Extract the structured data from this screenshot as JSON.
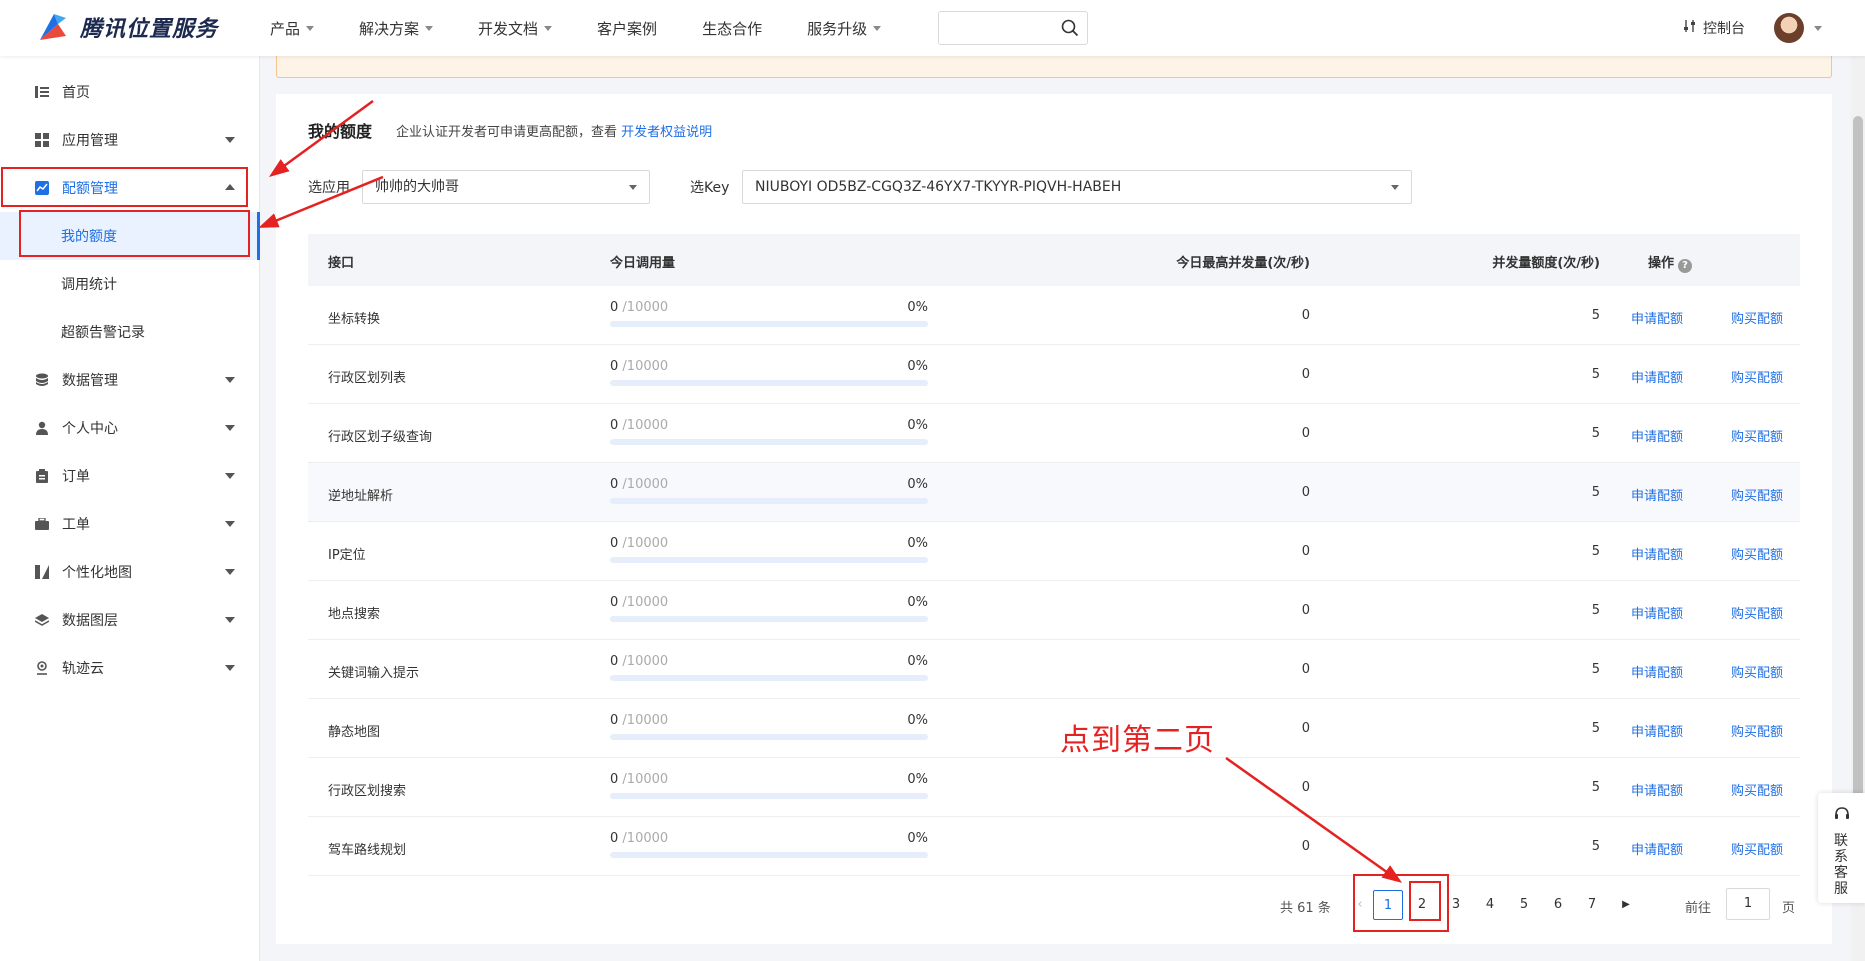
{
  "header": {
    "logo_text": "腾讯位置服务",
    "nav": [
      "产品",
      "解决方案",
      "开发文档",
      "客户案例",
      "生态合作",
      "服务升级"
    ],
    "search_placeholder": "",
    "console_label": "控制台"
  },
  "sidebar": {
    "items": [
      {
        "label": "首页"
      },
      {
        "label": "应用管理"
      },
      {
        "label": "配额管理"
      },
      {
        "label": "我的额度"
      },
      {
        "label": "调用统计"
      },
      {
        "label": "超额告警记录"
      },
      {
        "label": "数据管理"
      },
      {
        "label": "个人中心"
      },
      {
        "label": "订单"
      },
      {
        "label": "工单"
      },
      {
        "label": "个性化地图"
      },
      {
        "label": "数据图层"
      },
      {
        "label": "轨迹云"
      }
    ]
  },
  "main": {
    "title": "我的额度",
    "hint_prefix": "企业认证开发者可申请更高配额，查看",
    "hint_link": "开发者权益说明",
    "app_label": "选应用",
    "app_value": "帅帅的大帅哥",
    "key_label": "选Key",
    "key_value": "NIUBOYI OD5BZ-CGQ3Z-46YX7-TKYYR-PIQVH-HABEH"
  },
  "table": {
    "headers": {
      "api": "接口",
      "today_calls": "今日调用量",
      "peak_concurrency": "今日最高并发量(次/秒)",
      "concurrency_quota": "并发量额度(次/秒)",
      "actions": "操作"
    },
    "apply_label": "申请配额",
    "buy_label": "购买配额",
    "rows": [
      {
        "api": "坐标转换",
        "used": "0",
        "total": "/10000",
        "pct": "0%",
        "progress": 0,
        "peak": "0",
        "quota": "5"
      },
      {
        "api": "行政区划列表",
        "used": "0",
        "total": "/10000",
        "pct": "0%",
        "progress": 0,
        "peak": "0",
        "quota": "5"
      },
      {
        "api": "行政区划子级查询",
        "used": "0",
        "total": "/10000",
        "pct": "0%",
        "progress": 0,
        "peak": "0",
        "quota": "5"
      },
      {
        "api": "逆地址解析",
        "used": "0",
        "total": "/10000",
        "pct": "0%",
        "progress": 0,
        "peak": "0",
        "quota": "5"
      },
      {
        "api": "IP定位",
        "used": "0",
        "total": "/10000",
        "pct": "0%",
        "progress": 0,
        "peak": "0",
        "quota": "5"
      },
      {
        "api": "地点搜索",
        "used": "0",
        "total": "/10000",
        "pct": "0%",
        "progress": 0,
        "peak": "0",
        "quota": "5"
      },
      {
        "api": "关键词输入提示",
        "used": "0",
        "total": "/10000",
        "pct": "0%",
        "progress": 0,
        "peak": "0",
        "quota": "5"
      },
      {
        "api": "静态地图",
        "used": "0",
        "total": "/10000",
        "pct": "0%",
        "progress": 0,
        "peak": "0",
        "quota": "5"
      },
      {
        "api": "行政区划搜索",
        "used": "0",
        "total": "/10000",
        "pct": "0%",
        "progress": 0,
        "peak": "0",
        "quota": "5"
      },
      {
        "api": "驾车路线规划",
        "used": "0",
        "total": "/10000",
        "pct": "0%",
        "progress": 0,
        "peak": "0",
        "quota": "5"
      }
    ]
  },
  "pagination": {
    "total_text": "共 61 条",
    "pages": [
      "1",
      "2",
      "3",
      "4",
      "5",
      "6",
      "7"
    ],
    "current": "1",
    "goto_label": "前往",
    "goto_value": "1",
    "page_unit": "页"
  },
  "annotation": {
    "text": "点到第二页",
    "color": "#e52222"
  },
  "service": {
    "label": "联系客服"
  },
  "colors": {
    "accent": "#1f6fe5",
    "annotation": "#e52222"
  }
}
